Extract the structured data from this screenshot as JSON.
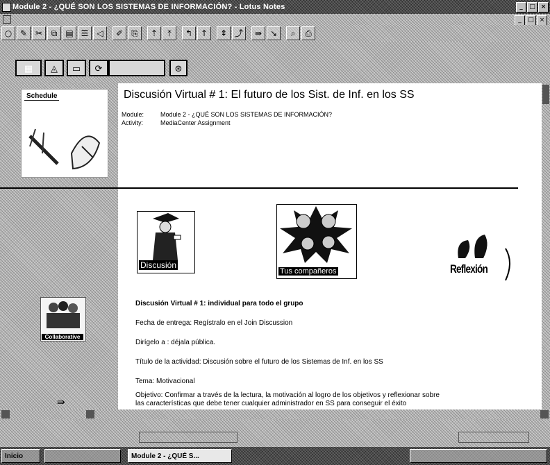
{
  "window": {
    "title": "Module 2 - ¿QUÉ SON LOS SISTEMAS DE INFORMACIÓN? - Lotus Notes",
    "controls": [
      "_",
      "□",
      "×"
    ]
  },
  "toolbar": {
    "icons": [
      "open-icon",
      "edit-icon",
      "scissors-icon",
      "copy-icon",
      "paste-icon",
      "list-icon",
      "send-icon",
      "pen-icon",
      "attach-icon",
      "up-icon",
      "top-icon",
      "prev-icon",
      "next-icon",
      "first-icon",
      "last-icon",
      "forward-icon",
      "back-icon",
      "search-icon",
      "print-icon"
    ]
  },
  "actionbar": {
    "buttons": [
      "grid",
      "up",
      "minus",
      "note",
      "wide",
      "refresh"
    ],
    "glyphs": [
      "▦",
      "◬",
      "▭",
      "⟳",
      "",
      "⊛"
    ]
  },
  "document": {
    "title": "Discusión Virtual # 1: El futuro de los Sist. de Inf. en los SS",
    "module_label": "Module:",
    "module_value": "Module 2 - ¿QUÉ SON LOS SISTEMAS DE INFORMACIÓN?",
    "activity_label": "Activity:",
    "activity_value": "MediaCenter Assignment"
  },
  "sidebar": {
    "schedule_label": "Schedule",
    "collaborative_label": "Collaborative"
  },
  "images": {
    "discussion_caption": "Discusión",
    "peers_caption": "Tus compañeros",
    "reflection_caption": "Reflexión"
  },
  "body": {
    "line1": "Discusión Virtual # 1: individual para todo el grupo",
    "line2": "Fecha de entrega: Regístralo en el Join Discussion",
    "line3": "Dirígelo a : déjala pública.",
    "line4": "Título de la actividad: Discusión sobre el futuro de los Sistemas de Inf. en los SS",
    "line5": "Tema: Motivacional",
    "line6": "Objetivo: Confirmar a través de la lectura, la motivación al logro de los objetivos y reflexionar sobre",
    "line7": "las características que debe tener cualquier administrador en SS para conseguir el éxito"
  },
  "taskbar": {
    "start": "Inicio",
    "task": "Module 2 - ¿QUÉ S..."
  }
}
